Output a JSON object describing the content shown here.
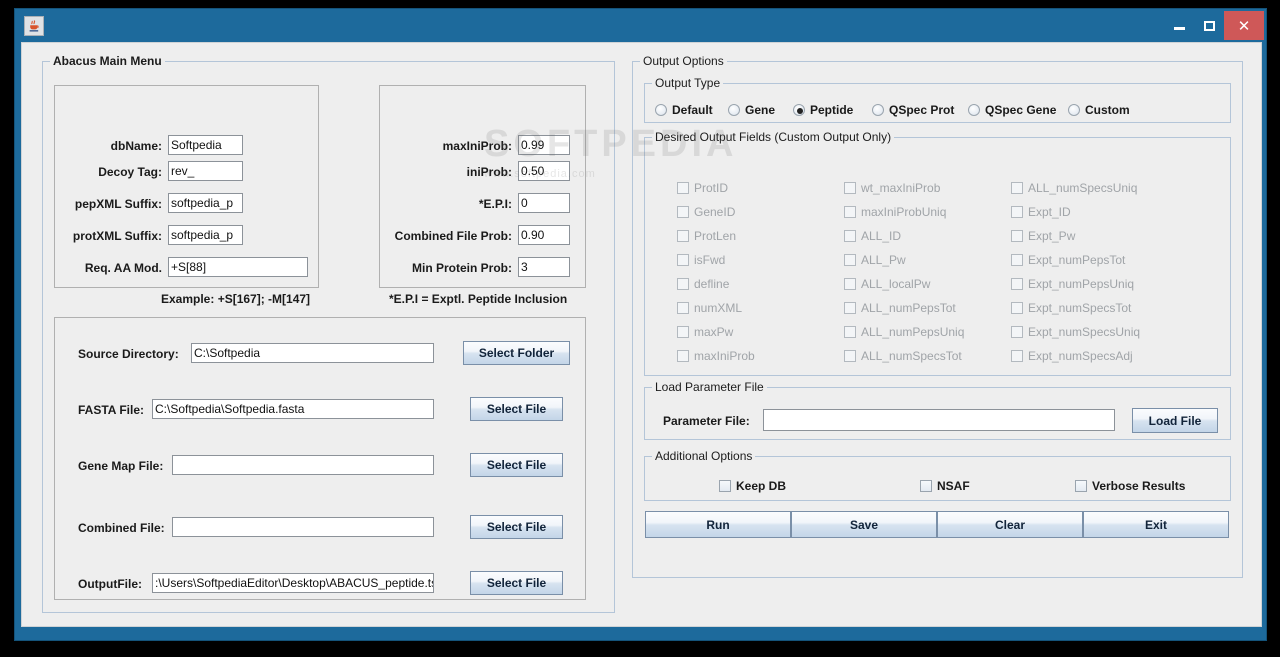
{
  "window": {
    "title": "",
    "icon": "java-coffee-cup-icon",
    "minimize_label": "Minimize",
    "maximize_label": "Maximize",
    "close_label": "✕",
    "frame_color": "#1d6a9c",
    "close_color": "#cf5858",
    "client_bg": "#eeeeee"
  },
  "main_menu": {
    "title": "Abacus Main Menu",
    "params_left": [
      {
        "label": "dbName:",
        "value": "Softpedia"
      },
      {
        "label": "Decoy Tag:",
        "value": "rev_"
      },
      {
        "label": "pepXML Suffix:",
        "value": "softpedia_p"
      },
      {
        "label": "protXML Suffix:",
        "value": "softpedia_p"
      },
      {
        "label": "Req. AA Mod.",
        "value": "+S[88]"
      }
    ],
    "example_note": "Example: +S[167]; -M[147]",
    "params_right": [
      {
        "label": "maxIniProb:",
        "value": "0.99"
      },
      {
        "label": "iniProb:",
        "value": "0.50"
      },
      {
        "label": "*E.P.I:",
        "value": "0"
      },
      {
        "label": "Combined File Prob:",
        "value": "0.90"
      },
      {
        "label": "Min Protein Prob:",
        "value": "3"
      }
    ],
    "epi_note": "*E.P.I = Exptl. Peptide Inclusion",
    "files": [
      {
        "label": "Source Directory:",
        "value": "C:\\Softpedia",
        "button": "Select Folder"
      },
      {
        "label": "FASTA File:",
        "value": "C:\\Softpedia\\Softpedia.fasta",
        "button": "Select File"
      },
      {
        "label": "Gene Map File:",
        "value": "",
        "button": "Select File"
      },
      {
        "label": "Combined File:",
        "value": "",
        "button": "Select File"
      },
      {
        "label": "OutputFile:",
        "value": ":\\Users\\SoftpediaEditor\\Desktop\\ABACUS_peptide.tsv",
        "button": "Select File"
      }
    ]
  },
  "output_options": {
    "title": "Output Options",
    "output_type": {
      "title": "Output Type",
      "options": [
        {
          "label": "Default",
          "selected": false
        },
        {
          "label": "Gene",
          "selected": false
        },
        {
          "label": "Peptide",
          "selected": true
        },
        {
          "label": "QSpec Prot",
          "selected": false
        },
        {
          "label": "QSpec Gene",
          "selected": false
        },
        {
          "label": "Custom",
          "selected": false
        }
      ],
      "selected_value": "Peptide"
    },
    "desired_fields": {
      "title": "Desired Output Fields (Custom Output Only)",
      "enabled": false,
      "column1": [
        {
          "label": "ProtID",
          "checked": false
        },
        {
          "label": "GeneID",
          "checked": false
        },
        {
          "label": "ProtLen",
          "checked": false
        },
        {
          "label": "isFwd",
          "checked": false
        },
        {
          "label": "defline",
          "checked": false
        },
        {
          "label": "numXML",
          "checked": false
        },
        {
          "label": "maxPw",
          "checked": false
        },
        {
          "label": "maxIniProb",
          "checked": false
        }
      ],
      "column2": [
        {
          "label": "wt_maxIniProb",
          "checked": false
        },
        {
          "label": "maxIniProbUniq",
          "checked": false
        },
        {
          "label": "ALL_ID",
          "checked": false
        },
        {
          "label": "ALL_Pw",
          "checked": false
        },
        {
          "label": "ALL_localPw",
          "checked": false
        },
        {
          "label": "ALL_numPepsTot",
          "checked": false
        },
        {
          "label": "ALL_numPepsUniq",
          "checked": false
        },
        {
          "label": "ALL_numSpecsTot",
          "checked": false
        }
      ],
      "column3": [
        {
          "label": "ALL_numSpecsUniq",
          "checked": false
        },
        {
          "label": "Expt_ID",
          "checked": false
        },
        {
          "label": "Expt_Pw",
          "checked": false
        },
        {
          "label": "Expt_numPepsTot",
          "checked": false
        },
        {
          "label": "Expt_numPepsUniq",
          "checked": false
        },
        {
          "label": "Expt_numSpecsTot",
          "checked": false
        },
        {
          "label": "Expt_numSpecsUniq",
          "checked": false
        },
        {
          "label": "Expt_numSpecsAdj",
          "checked": false
        }
      ]
    },
    "load_parameter_file": {
      "title": "Load Parameter File",
      "field_label": "Parameter File:",
      "field_value": "",
      "button": "Load File"
    },
    "additional_options": {
      "title": "Additional Options",
      "items": [
        {
          "label": "Keep DB",
          "checked": false
        },
        {
          "label": "NSAF",
          "checked": false
        },
        {
          "label": "Verbose Results",
          "checked": false
        }
      ]
    },
    "actions": [
      {
        "label": "Run"
      },
      {
        "label": "Save"
      },
      {
        "label": "Clear"
      },
      {
        "label": "Exit"
      }
    ]
  },
  "watermark": {
    "line1": "SOFTPEDIA",
    "line2": "www.softpedia.com"
  }
}
